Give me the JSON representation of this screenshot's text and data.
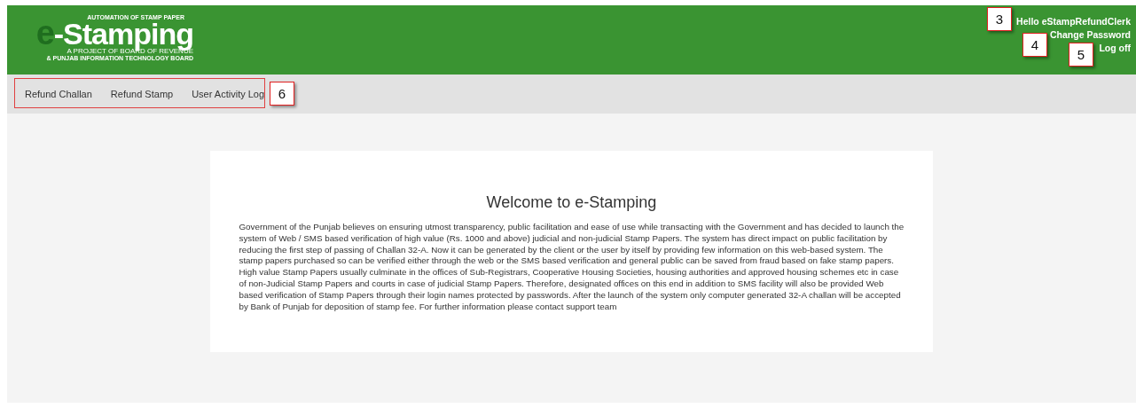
{
  "header": {
    "logo": {
      "tagline": "AUTOMATION OF STAMP PAPER",
      "mark": "e",
      "name": "-Stamping",
      "line_1": "A PROJECT OF BOARD OF REVENUE",
      "line_2": "& PUNJAB INFORMATION TECHNOLOGY BOARD"
    },
    "user_links": [
      "Hello eStampRefundClerk",
      "Change Password",
      "Log off"
    ]
  },
  "nav": {
    "items": [
      "Refund Challan",
      "Refund Stamp",
      "User Activity Log"
    ]
  },
  "callouts": [
    "3",
    "4",
    "5",
    "6"
  ],
  "welcome": {
    "title": "Welcome to e-Stamping",
    "body": "Government of the Punjab believes on ensuring utmost transparency, public facilitation and ease of use while transacting with the Government and has decided to launch the system of Web / SMS based verification of high value (Rs. 1000 and above) judicial and non-judicial Stamp Papers. The system has direct impact on public facilitation by reducing the first step of passing of Challan 32-A. Now it can be generated by the client or the user by itself by providing few information on this web-based system. The stamp papers purchased so can be verified either through the web or the SMS based verification and general public can be saved from fraud based on fake stamp papers. High value Stamp Papers usually culminate in the offices of Sub-Registrars, Cooperative Housing Societies, housing authorities and approved housing schemes etc in case of non-Judicial Stamp Papers and courts in case of judicial Stamp Papers. Therefore, designated offices on this end in addition to SMS facility will also be provided Web based verification of Stamp Papers through their login names protected by passwords. After the launch of the system only computer generated 32-A challan will be accepted by Bank of Punjab for deposition of stamp fee. For further information please contact support team"
  }
}
